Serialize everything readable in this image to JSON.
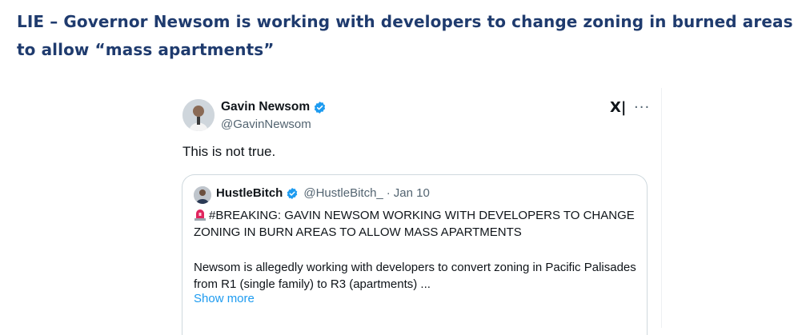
{
  "headline": "LIE – Governor Newsom is working with developers to change zoning in burned areas to allow “mass apartments”",
  "tweet": {
    "author_name": "Gavin Newsom",
    "author_handle": "@GavinNewsom",
    "text": "This is not true.",
    "icons": {
      "avatar": "avatar",
      "verified": "verified-badge-icon",
      "x_logo": "x-logo-icon",
      "more": "more-options-icon"
    },
    "x_logo_glyph": "X|",
    "more_glyph": "···",
    "colors": {
      "text": "#0f1419",
      "secondary": "#536471",
      "verified": "#1d9bf0",
      "link": "#1d9bf0",
      "headline": "#1f3b6e"
    }
  },
  "quoted_tweet": {
    "author_name": "HustleBitch",
    "author_handle": "@HustleBitch_",
    "separator": "·",
    "date": "Jan 10",
    "headline_text": "#BREAKING: GAVIN NEWSOM WORKING WITH DEVELOPERS TO CHANGE ZONING IN BURN AREAS TO ALLOW MASS APARTMENTS",
    "body_text": "Newsom is allegedly working with developers to convert zoning in Pacific Palisades from R1 (single family) to R3 (apartments)   ...",
    "show_more": "Show more",
    "icons": {
      "alert": "police-light-emoji-icon"
    }
  }
}
